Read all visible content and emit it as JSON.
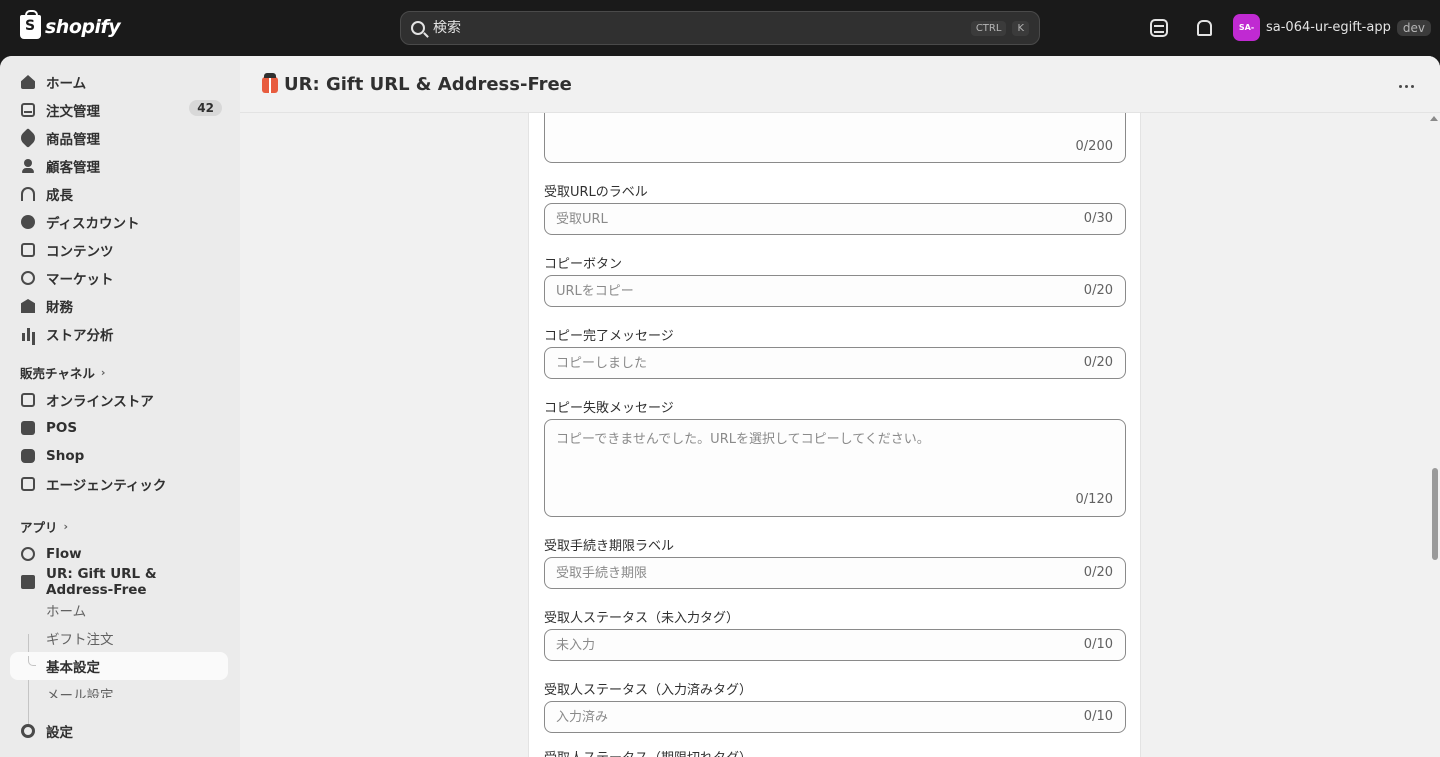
{
  "topbar": {
    "brand": "shopify",
    "search_placeholder": "検索",
    "kbd_ctrl": "CTRL",
    "kbd_k": "K",
    "account_initials": "SA-",
    "account_name": "sa-064-ur-egift-app",
    "env_badge": "dev"
  },
  "sidebar": {
    "items": [
      {
        "label": "ホーム",
        "icon": "home-icon"
      },
      {
        "label": "注文管理",
        "icon": "orders-icon",
        "count": "42"
      },
      {
        "label": "商品管理",
        "icon": "tag-icon"
      },
      {
        "label": "顧客管理",
        "icon": "person-icon"
      },
      {
        "label": "成長",
        "icon": "growth-icon"
      },
      {
        "label": "ディスカウント",
        "icon": "discount-icon"
      },
      {
        "label": "コンテンツ",
        "icon": "content-icon"
      },
      {
        "label": "マーケット",
        "icon": "globe-icon"
      },
      {
        "label": "財務",
        "icon": "bank-icon"
      },
      {
        "label": "ストア分析",
        "icon": "bar-chart-icon"
      }
    ],
    "sales_channels_label": "販売チャネル",
    "channels": [
      {
        "label": "オンラインストア",
        "icon": "store-icon"
      },
      {
        "label": "POS",
        "icon": "pos-icon"
      },
      {
        "label": "Shop",
        "icon": "shop-icon"
      },
      {
        "label": "エージェンティック",
        "icon": "agent-icon"
      }
    ],
    "apps_label": "アプリ",
    "apps": [
      {
        "label": "Flow",
        "icon": "flow-icon"
      },
      {
        "label": "UR: Gift URL & Address-Free",
        "icon": "gift-icon"
      }
    ],
    "app_subitems": [
      "ホーム",
      "ギフト注文",
      "基本設定",
      "メール設定"
    ],
    "settings_label": "設定"
  },
  "header": {
    "title": "UR: Gift URL & Address-Free"
  },
  "form": {
    "top_counter": "0/200",
    "fields": [
      {
        "label": "受取URLのラベル",
        "placeholder": "受取URL",
        "counter": "0/30"
      },
      {
        "label": "コピーボタン",
        "placeholder": "URLをコピー",
        "counter": "0/20"
      },
      {
        "label": "コピー完了メッセージ",
        "placeholder": "コピーしました",
        "counter": "0/20"
      },
      {
        "label": "コピー失敗メッセージ",
        "placeholder": "コピーできませんでした。URLを選択してコピーしてください。",
        "counter": "0/120"
      },
      {
        "label": "受取手続き期限ラベル",
        "placeholder": "受取手続き期限",
        "counter": "0/20"
      },
      {
        "label": "受取人ステータス（未入力タグ）",
        "placeholder": "未入力",
        "counter": "0/10"
      },
      {
        "label": "受取人ステータス（入力済みタグ）",
        "placeholder": "入力済み",
        "counter": "0/10"
      },
      {
        "label": "受取人ステータス（期限切れタグ）"
      }
    ]
  }
}
